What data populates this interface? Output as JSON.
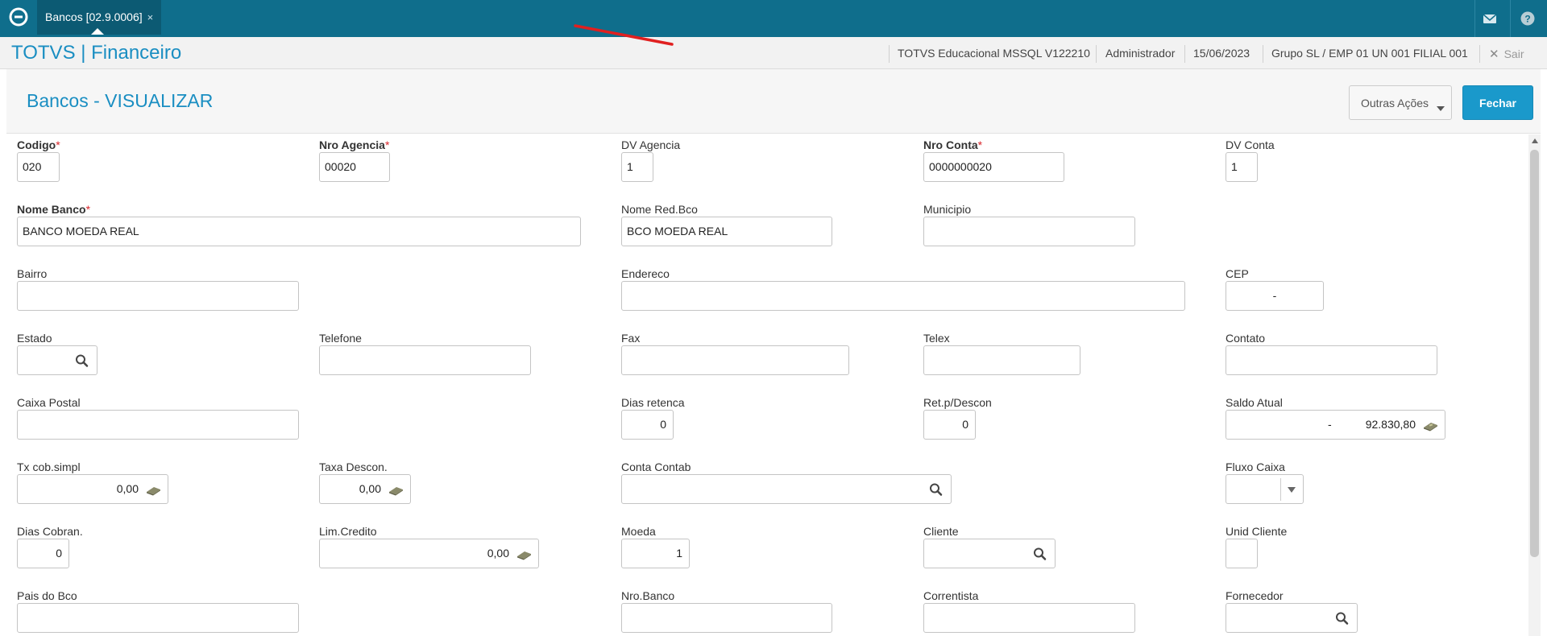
{
  "topbar": {
    "tab_label": "Bancos [02.9.0006]",
    "tab_close": "×",
    "icons": [
      "totvs-logo-icon",
      "mail-icon",
      "help-icon"
    ]
  },
  "header": {
    "brand": "TOTVS | Financeiro",
    "environment": "TOTVS Educacional MSSQL V122210",
    "user": "Administrador",
    "date": "15/06/2023",
    "company": "Grupo SL / EMP 01 UN 001 FILIAL 001",
    "exit_label": "Sair"
  },
  "page": {
    "title": "Bancos - VISUALIZAR",
    "other_actions_label": "Outras Ações",
    "close_label": "Fechar"
  },
  "form": {
    "codigo": {
      "label": "Codigo",
      "value": "020"
    },
    "nro_agencia": {
      "label": "Nro Agencia",
      "value": "00020"
    },
    "dv_agencia": {
      "label": "DV Agencia",
      "value": "1"
    },
    "nro_conta": {
      "label": "Nro Conta",
      "value": "0000000020"
    },
    "dv_conta": {
      "label": "DV Conta",
      "value": "1"
    },
    "nome_banco": {
      "label": "Nome Banco",
      "value": "BANCO MOEDA REAL"
    },
    "nome_red": {
      "label": "Nome Red.Bco",
      "value": "BCO MOEDA REAL"
    },
    "municipio": {
      "label": "Municipio",
      "value": ""
    },
    "bairro": {
      "label": "Bairro",
      "value": ""
    },
    "endereco": {
      "label": "Endereco",
      "value": ""
    },
    "cep": {
      "label": "CEP",
      "value": "-"
    },
    "estado": {
      "label": "Estado",
      "value": ""
    },
    "telefone": {
      "label": "Telefone",
      "value": ""
    },
    "fax": {
      "label": "Fax",
      "value": ""
    },
    "telex": {
      "label": "Telex",
      "value": ""
    },
    "contato": {
      "label": "Contato",
      "value": ""
    },
    "caixa_postal": {
      "label": "Caixa Postal",
      "value": ""
    },
    "dias_retenca": {
      "label": "Dias retenca",
      "value": "0"
    },
    "ret_descon": {
      "label": "Ret.p/Descon",
      "value": "0"
    },
    "saldo_atual": {
      "label": "Saldo Atual",
      "sign": "-",
      "value": "92.830,80"
    },
    "tx_cob_simpl": {
      "label": "Tx cob.simpl",
      "value": "0,00"
    },
    "taxa_descon": {
      "label": "Taxa Descon.",
      "value": "0,00"
    },
    "conta_contab": {
      "label": "Conta Contab",
      "value": ""
    },
    "fluxo_caixa": {
      "label": "Fluxo Caixa",
      "value": ""
    },
    "dias_cobran": {
      "label": "Dias Cobran.",
      "value": "0"
    },
    "lim_credito": {
      "label": "Lim.Credito",
      "value": "0,00"
    },
    "moeda": {
      "label": "Moeda",
      "value": "1"
    },
    "cliente": {
      "label": "Cliente",
      "value": ""
    },
    "unid_cliente": {
      "label": "Unid Cliente",
      "value": ""
    },
    "pais_bco": {
      "label": "Pais do Bco",
      "value": ""
    },
    "nro_banco": {
      "label": "Nro.Banco",
      "value": ""
    },
    "correntista": {
      "label": "Correntista",
      "value": ""
    },
    "fornecedor": {
      "label": "Fornecedor",
      "value": ""
    }
  },
  "colors": {
    "topbar": "#0f6e8c",
    "accent": "#1a8ec2",
    "primary_button": "#1a99cb",
    "required": "#d9252a",
    "annotation": "#e02020"
  }
}
